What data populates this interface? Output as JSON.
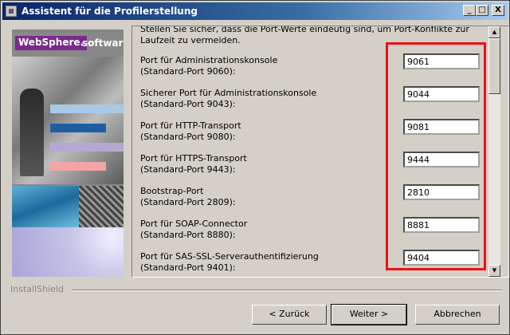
{
  "window": {
    "title": "Assistent für die Profilerstellung"
  },
  "title_buttons": {
    "minimize": "_",
    "maximize": "□",
    "close": "X"
  },
  "branding": {
    "websphere": "WebSphere.",
    "software": "software"
  },
  "intro_text": "Stellen Sie sicher, dass die Port-Werte eindeutig sind, um Port-Konflikte zur Laufzeit zu vermeiden.",
  "ports": [
    {
      "label": "Port für Administrationskonsole",
      "default": "(Standard-Port 9060):",
      "value": "9061"
    },
    {
      "label": "Sicherer Port für Administrationskonsole",
      "default": "(Standard-Port 9043):",
      "value": "9044"
    },
    {
      "label": "Port für HTTP-Transport",
      "default": "(Standard-Port 9080):",
      "value": "9081"
    },
    {
      "label": "Port für HTTPS-Transport",
      "default": "(Standard-Port 9443):",
      "value": "9444"
    },
    {
      "label": "Bootstrap-Port",
      "default": "(Standard-Port 2809):",
      "value": "2810"
    },
    {
      "label": "Port für SOAP-Connector",
      "default": "(Standard-Port 8880):",
      "value": "8881"
    },
    {
      "label": "Port für SAS-SSL-Serverauthentifizierung",
      "default": "(Standard-Port 9401):",
      "value": "9404"
    }
  ],
  "footer": {
    "installshield": "InstallShield",
    "back": "< Zurück",
    "next": "Weiter >",
    "cancel": "Abbrechen"
  },
  "colors": {
    "highlight": "#e11111",
    "titlebar": "#0a246a"
  }
}
